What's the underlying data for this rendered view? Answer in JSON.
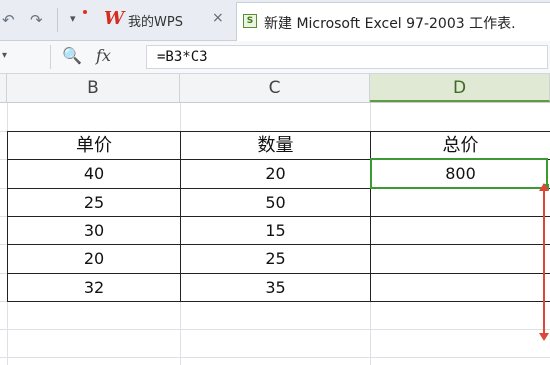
{
  "tabs": {
    "home_label": "我的WPS",
    "home_logo": "W",
    "home_close": "×",
    "file_label": "新建 Microsoft Excel 97-2003 工作表.",
    "file_icon_text": "S"
  },
  "toolbar": {
    "undo_icon": "↶",
    "redo_icon": "↷",
    "dropdown_icon": "▾"
  },
  "formula_bar": {
    "namebox_arrow": "▾",
    "zoom_icon": "🔍",
    "fx_label": "fx",
    "formula": "=B3*C3"
  },
  "columns": [
    "B",
    "C",
    "D"
  ],
  "active_column": "D",
  "table": {
    "headers": [
      "单价",
      "数量",
      "总价"
    ],
    "rows": [
      [
        "40",
        "20",
        "800"
      ],
      [
        "25",
        "50",
        ""
      ],
      [
        "30",
        "15",
        ""
      ],
      [
        "20",
        "25",
        ""
      ],
      [
        "32",
        "35",
        ""
      ]
    ]
  },
  "colors": {
    "selection": "#3c9a33",
    "fill_arrow": "#e0453a",
    "wps_red": "#d62b1f"
  }
}
